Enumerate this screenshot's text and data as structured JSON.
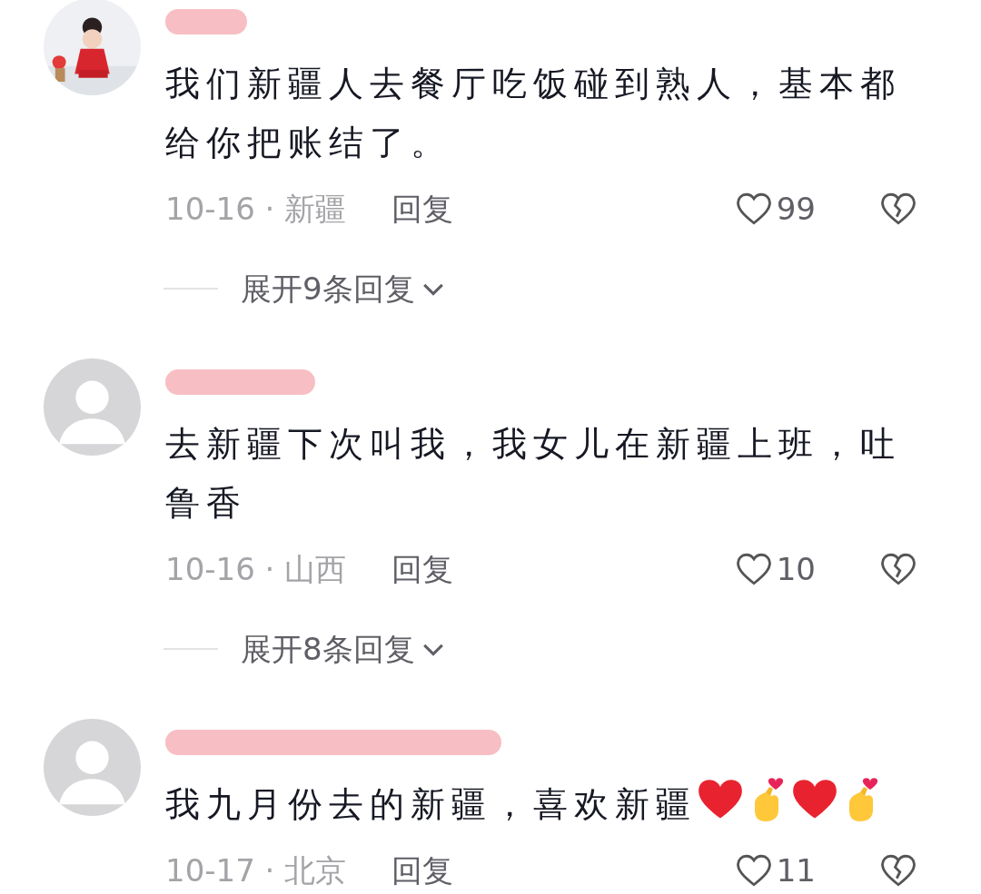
{
  "comments": [
    {
      "name_redacted": true,
      "content": [
        {
          "kind": "text",
          "text": "我们新疆人去餐厅吃饭碰到熟人，基本都给你把账结了。"
        }
      ],
      "meta": "10-16 · 新疆",
      "reply_label": "回复",
      "likes": "99",
      "expand_label": "展开9条回复"
    },
    {
      "avatar": {
        "kind": "default"
      },
      "name_redacted": true,
      "content": [
        {
          "kind": "text",
          "text": "去新疆下次叫我，我女儿在新疆上班，吐鲁香"
        }
      ],
      "meta": "10-16 · 山西",
      "reply_label": "回复",
      "likes": "10",
      "expand_label": "展开8条回复"
    },
    {
      "avatar": {
        "kind": "default"
      },
      "name_redacted": true,
      "content": [
        {
          "kind": "text",
          "text": "我九月份去的新疆，喜欢新疆"
        },
        {
          "kind": "heart"
        },
        {
          "kind": "finger_heart"
        },
        {
          "kind": "heart"
        },
        {
          "kind": "finger_heart"
        }
      ],
      "meta": "10-17 · 北京",
      "reply_label": "回复",
      "likes": "11"
    }
  ]
}
